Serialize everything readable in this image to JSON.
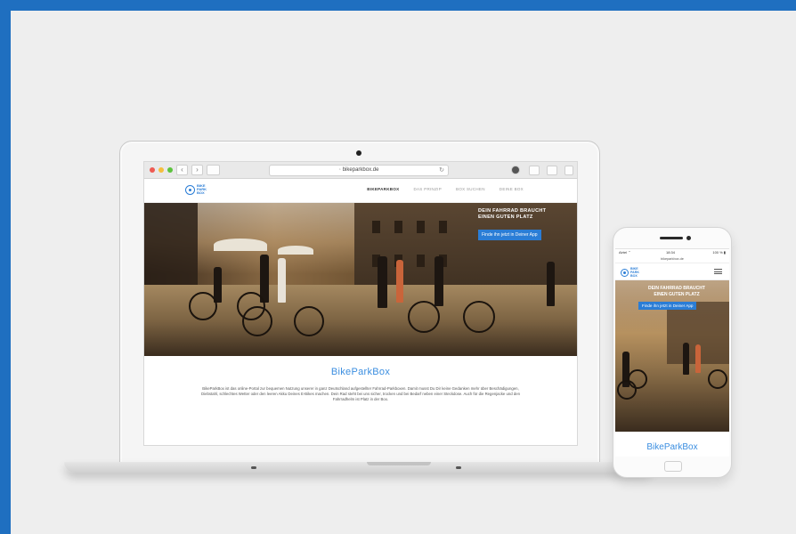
{
  "laptop": {
    "browser": {
      "url": "bikeparkbox.de",
      "nav_back": "‹",
      "nav_forward": "›",
      "sidebar_icon": "sidebar-icon",
      "reload_icon": "↻"
    },
    "site": {
      "logo_text": "BIKE PARK BOX",
      "menu": [
        {
          "label": "BIKEPARKBOX",
          "active": true
        },
        {
          "label": "DAS PRINZIP"
        },
        {
          "label": "BOX SUCHEN"
        },
        {
          "label": "DEINE BOX"
        }
      ],
      "hero": {
        "title_line1": "DEIN FAHRRAD BRAUCHT",
        "title_line2": "EINEN GUTEN PLATZ",
        "cta": "Finde ihn jetzt in Deiner App"
      },
      "content": {
        "title": "BikeParkBox",
        "body": "BikeParkBox ist das online-Portal zur bequemen Nutzung unserer in ganz Deutschland aufgestellter Fahrrad-Parkboxen. Damit musst Du Dir keine Gedanken mehr über Beschädigungen, Diebstahl, schlechtes Wetter oder den leeren Akku Deines E-Bikes machen. Dein Rad steht bei uns sicher, trocken und bei Bedarf neben einer Steckdose. Auch für die Regenjacke und den Fahrradhelm ist Platz in der Box."
      }
    }
  },
  "phone": {
    "status": {
      "carrier": "Airtel ⌃",
      "time": "18:34",
      "battery": "100 % ▮"
    },
    "url": "bikeparkbox.de",
    "logo_text": "BIKE PARK BOX",
    "hero": {
      "title_line1": "DEIN FAHRRAD BRAUCHT",
      "title_line2": "EINEN GUTEN PLATZ",
      "cta": "Finde ihn jetzt in Deiner App"
    },
    "content_title": "BikeParkBox"
  },
  "colors": {
    "frame_blue": "#1f6fc0",
    "accent_blue": "#2a7dd6",
    "title_blue": "#3b8ee0"
  }
}
